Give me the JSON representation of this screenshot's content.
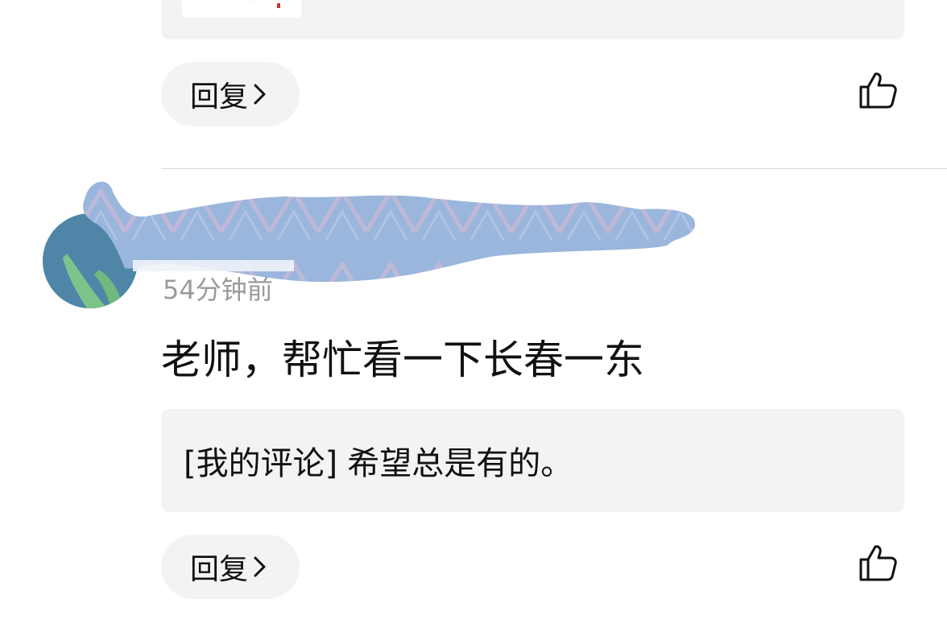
{
  "previous_comment": {
    "reply_label": "回复"
  },
  "comment": {
    "time_ago": "54分钟前",
    "text": "老师，帮忙看一下长春一东",
    "my_comment_prefix": "[我的评论]",
    "my_comment_text": "希望总是有的。",
    "reply_label": "回复"
  },
  "icons": {
    "like": "thumbs-up-outline-icon",
    "chevron": "chevron-right-icon"
  },
  "colors": {
    "bubble_bg": "#f2f3f5",
    "time_text": "#9a9a9a",
    "redaction": "#9ab6dc"
  }
}
